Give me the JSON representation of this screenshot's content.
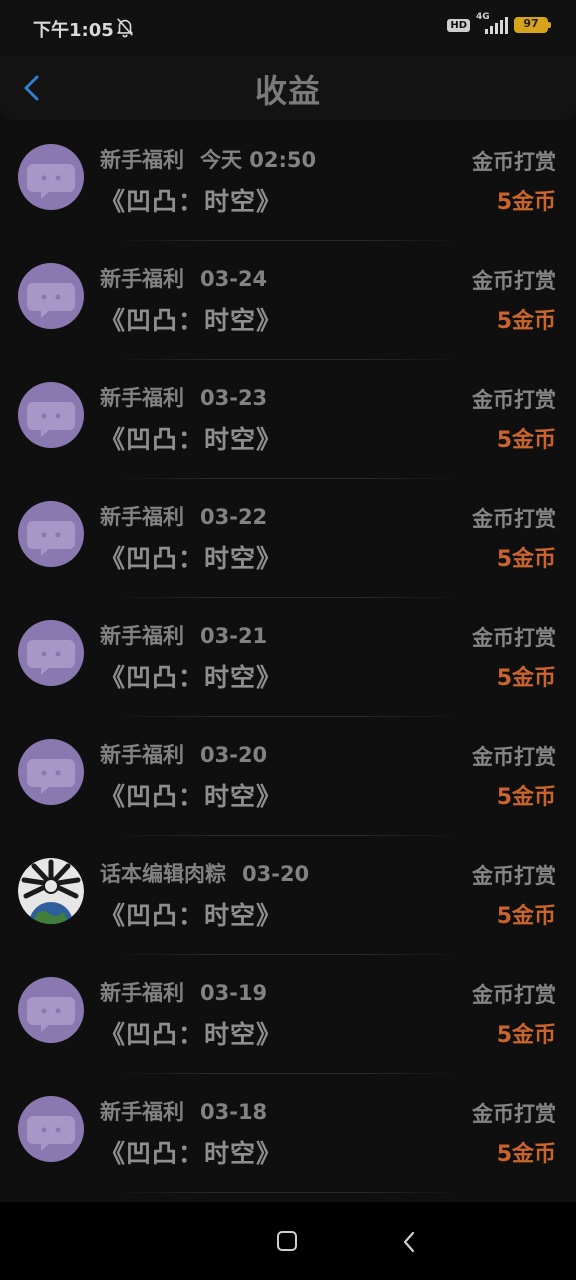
{
  "status_bar": {
    "time": "下午1:05",
    "hd": "HD",
    "network": "4G",
    "battery": "97",
    "icons": [
      "bell-muted-icon",
      "signal-icon",
      "battery-icon"
    ]
  },
  "header": {
    "title": "收益",
    "back_icon": "chevron-left-icon"
  },
  "colors": {
    "background": "#0f0f0f",
    "accent_back": "#2f7fd0",
    "reward": "#c9642e",
    "avatar": "#8a78b0"
  },
  "items": [
    {
      "sender": "新手福利",
      "date": "今天 02:50",
      "work": "《凹凸：时空》",
      "type": "金币打赏",
      "amount": "5金币",
      "avatar": "chat-bubble-icon"
    },
    {
      "sender": "新手福利",
      "date": "03-24",
      "work": "《凹凸：时空》",
      "type": "金币打赏",
      "amount": "5金币",
      "avatar": "chat-bubble-icon"
    },
    {
      "sender": "新手福利",
      "date": "03-23",
      "work": "《凹凸：时空》",
      "type": "金币打赏",
      "amount": "5金币",
      "avatar": "chat-bubble-icon"
    },
    {
      "sender": "新手福利",
      "date": "03-22",
      "work": "《凹凸：时空》",
      "type": "金币打赏",
      "amount": "5金币",
      "avatar": "chat-bubble-icon"
    },
    {
      "sender": "新手福利",
      "date": "03-21",
      "work": "《凹凸：时空》",
      "type": "金币打赏",
      "amount": "5金币",
      "avatar": "chat-bubble-icon"
    },
    {
      "sender": "新手福利",
      "date": "03-20",
      "work": "《凹凸：时空》",
      "type": "金币打赏",
      "amount": "5金币",
      "avatar": "chat-bubble-icon"
    },
    {
      "sender": "话本编辑肉粽",
      "date": "03-20",
      "work": "《凹凸：时空》",
      "type": "金币打赏",
      "amount": "5金币",
      "avatar": "user-photo"
    },
    {
      "sender": "新手福利",
      "date": "03-19",
      "work": "《凹凸：时空》",
      "type": "金币打赏",
      "amount": "5金币",
      "avatar": "chat-bubble-icon"
    },
    {
      "sender": "新手福利",
      "date": "03-18",
      "work": "《凹凸：时空》",
      "type": "金币打赏",
      "amount": "5金币",
      "avatar": "chat-bubble-icon"
    }
  ],
  "nav_bar": {
    "icons": [
      "home-square-icon",
      "back-chevron-icon"
    ]
  }
}
